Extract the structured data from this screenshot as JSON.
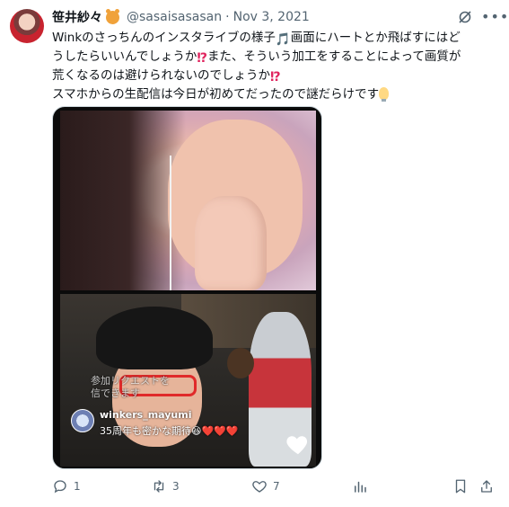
{
  "author": {
    "display_name": "笹井紗々",
    "handle": "@sasaisasasan",
    "separator": "·",
    "date": "Nov 3, 2021"
  },
  "tweet_text": {
    "line1_a": "Winkのさっちんのインスタライブの様子",
    "line1_b": "画面にハートとか飛ばすにはど",
    "line2_a": "うしたらいいんでしょうか",
    "line2_b": "また、そういう加工をすることによって画質が",
    "line3_a": "荒くなるのは避けられないのでしょうか",
    "line4": "スマホからの生配信は今日が初めてだったので謎だらけです",
    "emoji_note": "🎵",
    "emoji_q": "⁉"
  },
  "media": {
    "join_overlay_1": "参加リクエストを",
    "join_overlay_2": "信できます",
    "comment_user": "winkers_mayumi",
    "comment_text": "35周年も密かな期待😆❤️❤️❤️"
  },
  "actions": {
    "reply_count": "1",
    "retweet_count": "3",
    "like_count": "7"
  },
  "icons": {
    "reply": "reply-icon",
    "retweet": "retweet-icon",
    "like": "heart-icon",
    "views": "analytics-icon",
    "bookmark": "bookmark-icon",
    "share": "share-icon",
    "grok": "grok-icon",
    "more": "more-icon"
  },
  "colors": {
    "text": "#0f1419",
    "secondary": "#536471",
    "accent_note": "#55acee",
    "accent_q": "#e0245e"
  }
}
